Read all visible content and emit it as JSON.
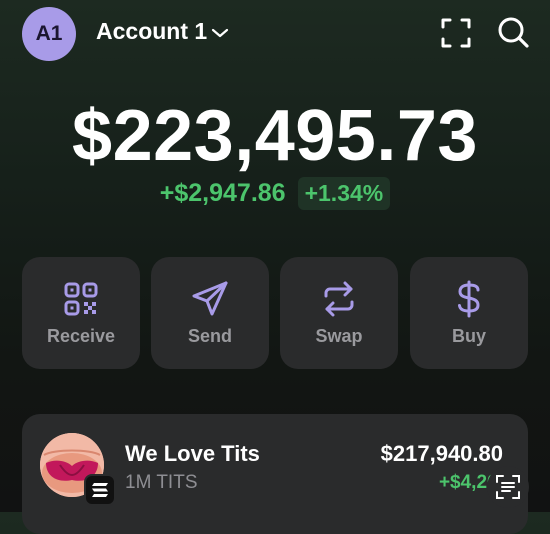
{
  "header": {
    "avatar_initials": "A1",
    "account_name": "Account 1",
    "icons": [
      "chevron-down-icon",
      "scan-icon",
      "search-icon"
    ]
  },
  "portfolio": {
    "balance": "$223,495.73",
    "change_amount": "+$2,947.86",
    "change_percent": "+1.34%"
  },
  "actions": [
    {
      "label": "Receive",
      "icon": "qr-code-icon"
    },
    {
      "label": "Send",
      "icon": "send-icon"
    },
    {
      "label": "Swap",
      "icon": "swap-icon"
    },
    {
      "label": "Buy",
      "icon": "dollar-icon"
    }
  ],
  "tokens": [
    {
      "name": "We Love Tits",
      "amount": "1M TITS",
      "value": "$217,940.80",
      "change": "+$4,268.5"
    }
  ],
  "colors": {
    "accent": "#a89be8",
    "positive": "#4cc46c",
    "card": "#2a2b2c"
  }
}
